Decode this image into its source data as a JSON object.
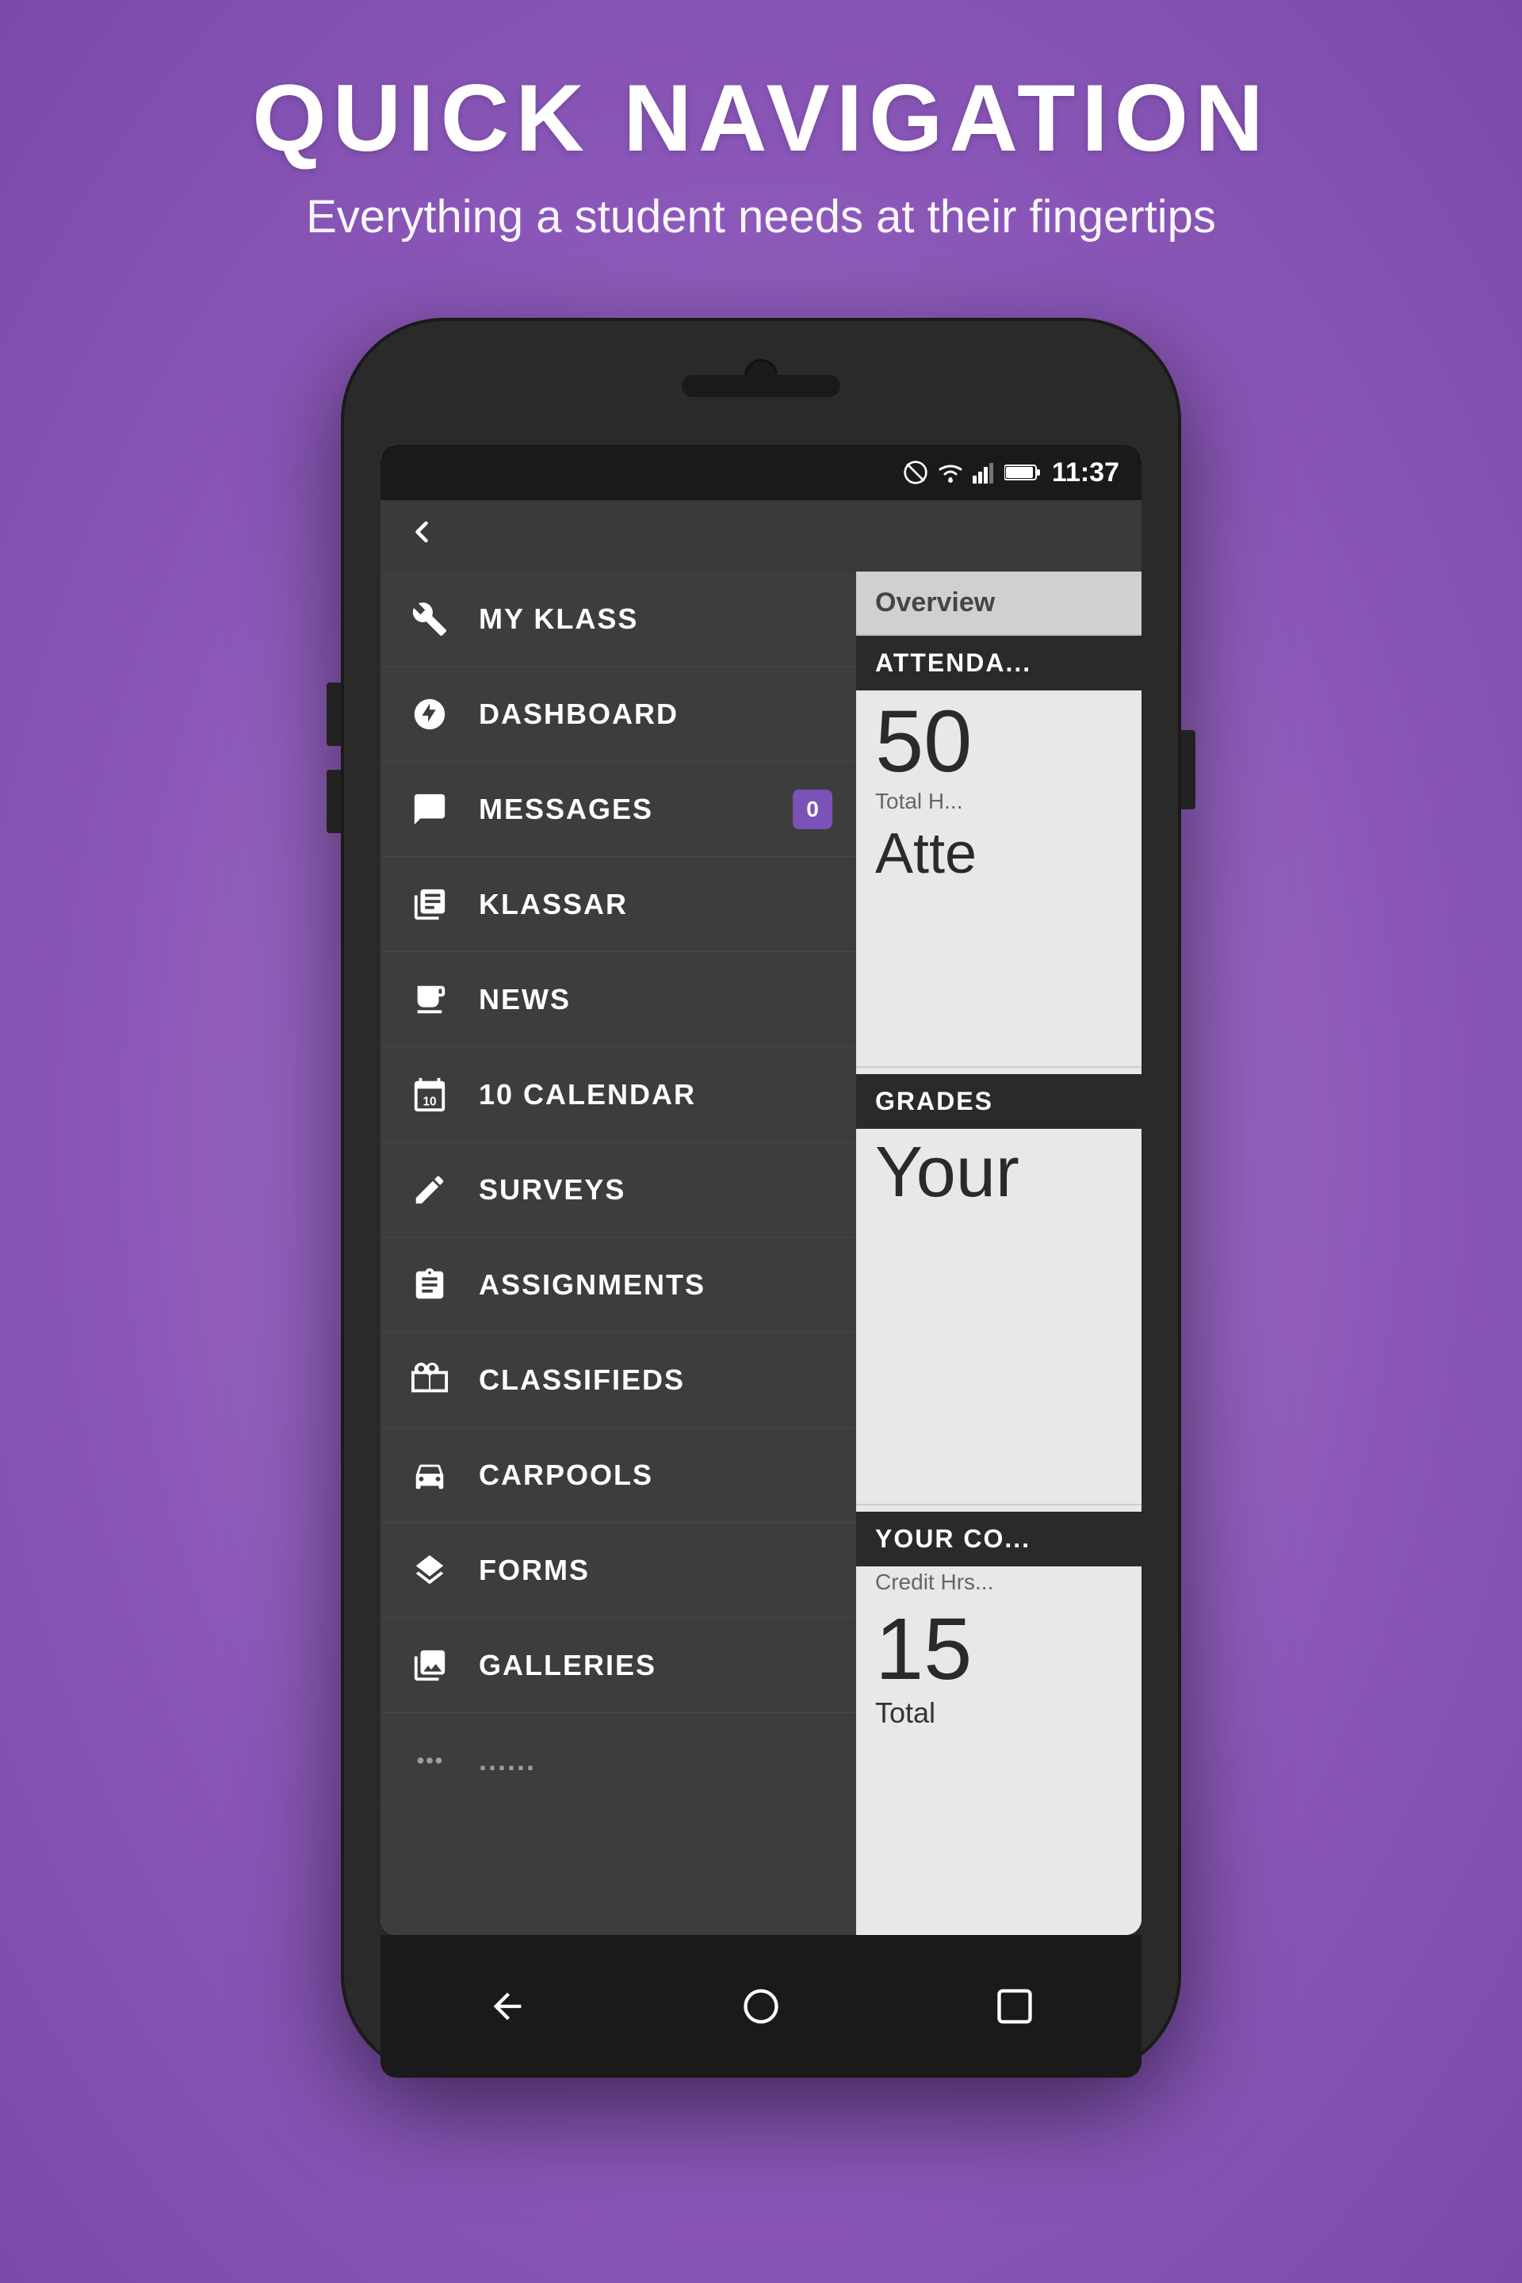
{
  "header": {
    "title": "QUICK NAVIGATION",
    "subtitle": "Everything a student needs at their fingertips"
  },
  "status_bar": {
    "time": "11:37",
    "icons": [
      "circle-slash",
      "wifi",
      "signal",
      "battery"
    ]
  },
  "nav_items": [
    {
      "id": "my-klass",
      "label": "MY KLASS",
      "icon": "wrench"
    },
    {
      "id": "dashboard",
      "label": "DASHBOARD",
      "icon": "gauge"
    },
    {
      "id": "messages",
      "label": "MESSAGES",
      "icon": "chat",
      "badge": "0"
    },
    {
      "id": "klassar",
      "label": "KlassAR",
      "icon": "scan"
    },
    {
      "id": "news",
      "label": "NEWS",
      "icon": "news"
    },
    {
      "id": "calendar",
      "label": "CALENDAR",
      "icon": "calendar",
      "number": "10"
    },
    {
      "id": "surveys",
      "label": "SURVEYS",
      "icon": "pencil"
    },
    {
      "id": "assignments",
      "label": "ASSIGNMENTS",
      "icon": "assignment"
    },
    {
      "id": "classifieds",
      "label": "CLASSIFIEDS",
      "icon": "classifieds"
    },
    {
      "id": "carpools",
      "label": "CARPOOLS",
      "icon": "car"
    },
    {
      "id": "forms",
      "label": "FORMS",
      "icon": "layers"
    },
    {
      "id": "galleries",
      "label": "GALLERIES",
      "icon": "gallery"
    },
    {
      "id": "more",
      "label": "...",
      "icon": "more"
    }
  ],
  "overview": {
    "tab_label": "Overview",
    "attendance_header": "ATTENDA...",
    "attendance_value": "50",
    "attendance_label": "Total H...",
    "attendance_sub": "Atte",
    "grades_header": "GRADES",
    "grades_value": "Your",
    "courses_header": "YOUR CO...",
    "courses_label": "Credit Hrs...",
    "courses_value": "15",
    "courses_sub": "Total"
  },
  "bottom_nav": {
    "back": "◁",
    "home": "○",
    "recent": "□"
  },
  "colors": {
    "background": "#9b6fc7",
    "phone_body": "#2a2a2a",
    "nav_drawer": "#3d3d3d",
    "status_bar": "#1a1a1a",
    "accent": "#7b52b8",
    "section_header_bg": "#2a2a2a"
  }
}
